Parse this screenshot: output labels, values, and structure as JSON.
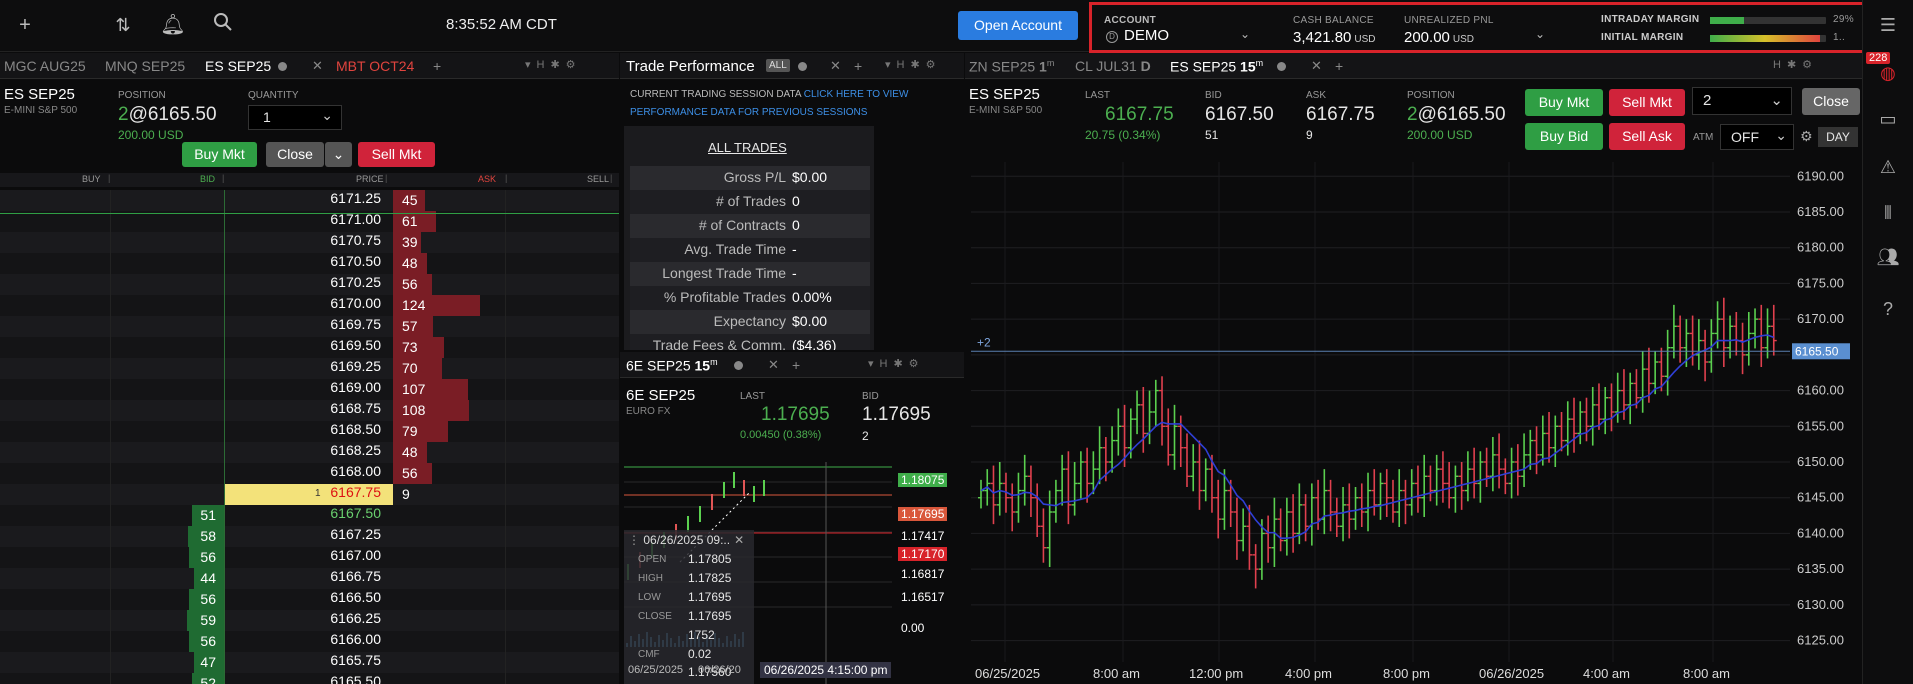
{
  "topbar": {
    "clock": "8:35:52 AM CDT",
    "open_account": "Open Account"
  },
  "account": {
    "account_label": "ACCOUNT",
    "account_value": "DEMO",
    "cash_label": "CASH BALANCE",
    "cash_value": "3,421.80",
    "cash_unit": "USD",
    "pnl_label": "UNREALIZED PNL",
    "pnl_value": "200.00",
    "pnl_unit": "USD",
    "intraday_label": "INTRADAY MARGIN",
    "intraday_pct": "29%",
    "intraday_fraction": 0.29,
    "initial_label": "INITIAL MARGIN",
    "initial_pct": "1..",
    "initial_fraction": 0.95
  },
  "notification_count": "228",
  "left_tabs": [
    "MGC AUG25",
    "MNQ SEP25",
    "ES SEP25",
    "MBT OCT24"
  ],
  "dom": {
    "symbol": "ES SEP25",
    "desc": "E-MINI S&P 500",
    "position_label": "POSITION",
    "position_qty": "2",
    "position_price": "@6165.50",
    "position_pnl": "200.00 USD",
    "quantity_label": "QUANTITY",
    "quantity_value": "1",
    "buy_mkt": "Buy Mkt",
    "close": "Close",
    "sell_mkt": "Sell Mkt",
    "headers": {
      "buy": "BUY",
      "bid": "BID",
      "price": "PRICE",
      "ask": "ASK",
      "sell": "SELL"
    },
    "ask_rows": [
      {
        "price": "6171.25",
        "ask": "45"
      },
      {
        "price": "6171.00",
        "ask": "61"
      },
      {
        "price": "6170.75",
        "ask": "39"
      },
      {
        "price": "6170.50",
        "ask": "48"
      },
      {
        "price": "6170.25",
        "ask": "56"
      },
      {
        "price": "6170.00",
        "ask": "124"
      },
      {
        "price": "6169.75",
        "ask": "57"
      },
      {
        "price": "6169.50",
        "ask": "73"
      },
      {
        "price": "6169.25",
        "ask": "70"
      },
      {
        "price": "6169.00",
        "ask": "107"
      },
      {
        "price": "6168.75",
        "ask": "108"
      },
      {
        "price": "6168.50",
        "ask": "79"
      },
      {
        "price": "6168.25",
        "ask": "48"
      },
      {
        "price": "6168.00",
        "ask": "56"
      }
    ],
    "last_row": {
      "marker": "1",
      "price": "6167.75",
      "ask": "9"
    },
    "bid_rows": [
      {
        "price": "6167.50",
        "bid": "51"
      },
      {
        "price": "6167.25",
        "bid": "58"
      },
      {
        "price": "6167.00",
        "bid": "56"
      },
      {
        "price": "6166.75",
        "bid": "44"
      },
      {
        "price": "6166.50",
        "bid": "56"
      },
      {
        "price": "6166.25",
        "bid": "59"
      },
      {
        "price": "6166.00",
        "bid": "56"
      },
      {
        "price": "6165.75",
        "bid": "47"
      },
      {
        "price": "6165.50",
        "bid": "52"
      }
    ]
  },
  "trade_perf": {
    "tab": "Trade Performance",
    "all_badge": "ALL",
    "note_plain": "CURRENT TRADING SESSION DATA ",
    "note_link": "CLICK HERE TO VIEW PERFORMANCE DATA FOR PREVIOUS SESSIONS",
    "section": "ALL TRADES",
    "rows": [
      {
        "k": "Gross P/L",
        "v": "$0.00"
      },
      {
        "k": "# of Trades",
        "v": "0"
      },
      {
        "k": "# of Contracts",
        "v": "0"
      },
      {
        "k": "Avg. Trade Time",
        "v": "-"
      },
      {
        "k": "Longest Trade Time",
        "v": "-"
      },
      {
        "k": "% Profitable Trades",
        "v": "0.00%"
      },
      {
        "k": "Expectancy",
        "v": "$0.00"
      },
      {
        "k": "Trade Fees & Comm.",
        "v": "($4.36)"
      }
    ]
  },
  "mini": {
    "tab": "6E SEP25",
    "tab_tf": "15",
    "tab_unit": "m",
    "symbol": "6E SEP25",
    "desc": "EURO FX",
    "last_label": "LAST",
    "last": "1.17695",
    "change": "0.00450 (0.38%)",
    "bid_label": "BID",
    "bid": "1.17695",
    "bid_size": "2",
    "tooltip_date": "06/26/2025 09:..",
    "open_label": "OPEN",
    "open": "1.17805",
    "high_label": "HIGH",
    "high": "1.17825",
    "low_label": "LOW",
    "low": "1.17695",
    "close_label": "CLOSE",
    "close": "1.17695",
    "vol": "1752",
    "cmf_label": "CMF",
    "cmf": "0.02",
    "extra": "1.17560",
    "price_tags": [
      "1.18075",
      "1.17695",
      "1.17417",
      "1.17170",
      "1.16817",
      "1.16517",
      "0.00"
    ],
    "x_labels": [
      "06/25/2025",
      "06/26/20",
      "06/26/2025 4:15:00 pm"
    ]
  },
  "right_tabs": [
    {
      "label": "ZN SEP25",
      "tf": "1",
      "unit": "m"
    },
    {
      "label": "CL JUL31",
      "tf": "D",
      "unit": ""
    },
    {
      "label": "ES SEP25",
      "tf": "15",
      "unit": "m"
    }
  ],
  "chart_header": {
    "symbol": "ES SEP25",
    "desc": "E-MINI S&P 500",
    "last_label": "LAST",
    "last": "6167.75",
    "change": "20.75 (0.34%)",
    "bid_label": "BID",
    "bid": "6167.50",
    "bid_size": "51",
    "ask_label": "ASK",
    "ask": "6167.75",
    "ask_size": "9",
    "position_label": "POSITION",
    "position_qty": "2",
    "position_price": "@6165.50",
    "position_pnl": "200.00 USD",
    "buy_mkt": "Buy Mkt",
    "sell_mkt": "Sell Mkt",
    "buy_bid": "Buy Bid",
    "sell_ask": "Sell Ask",
    "qty": "2",
    "close": "Close",
    "atm_label": "ATM",
    "atm_value": "OFF",
    "day": "DAY"
  },
  "chart_data": {
    "type": "candlestick",
    "y_ticks": [
      "6190.00",
      "6185.00",
      "6180.00",
      "6175.00",
      "6170.00",
      "6165.00",
      "6160.00",
      "6155.00",
      "6150.00",
      "6145.00",
      "6140.00",
      "6135.00",
      "6130.00",
      "6125.00"
    ],
    "ylim": [
      6122,
      6192
    ],
    "x_labels": [
      "06/25/2025",
      "8:00 am",
      "12:00 pm",
      "4:00 pm",
      "8:00 pm",
      "06/26/2025",
      "4:00 am",
      "8:00 am"
    ],
    "position_line": {
      "label": "+2",
      "price": "6165.50"
    },
    "closes": [
      6146,
      6147,
      6144,
      6147,
      6145,
      6143,
      6146,
      6148,
      6145,
      6141,
      6138,
      6143,
      6146,
      6149,
      6144,
      6147,
      6150,
      6147,
      6149,
      6152,
      6150,
      6153,
      6155,
      6152,
      6156,
      6158,
      6154,
      6157,
      6160,
      6155,
      6151,
      6155,
      6152,
      6148,
      6150,
      6146,
      6149,
      6145,
      6142,
      6146,
      6143,
      6139,
      6141,
      6137,
      6135,
      6140,
      6138,
      6142,
      6139,
      6143,
      6140,
      6144,
      6141,
      6145,
      6142,
      6146,
      6143,
      6141,
      6144,
      6142,
      6145,
      6143,
      6146,
      6144,
      6147,
      6145,
      6143,
      6146,
      6144,
      6147,
      6145,
      6148,
      6146,
      6149,
      6147,
      6145,
      6148,
      6146,
      6149,
      6147,
      6150,
      6148,
      6151,
      6149,
      6147,
      6150,
      6148,
      6151,
      6153,
      6151,
      6154,
      6152,
      6155,
      6153,
      6156,
      6154,
      6157,
      6155,
      6158,
      6156,
      6159,
      6157,
      6160,
      6158,
      6161,
      6159,
      6163,
      6161,
      6164,
      6162,
      6166,
      6169,
      6166,
      6168,
      6165,
      6167,
      6164,
      6168,
      6170,
      6166,
      6169,
      6167,
      6165,
      6168,
      6170,
      6166,
      6169,
      6167
    ]
  }
}
